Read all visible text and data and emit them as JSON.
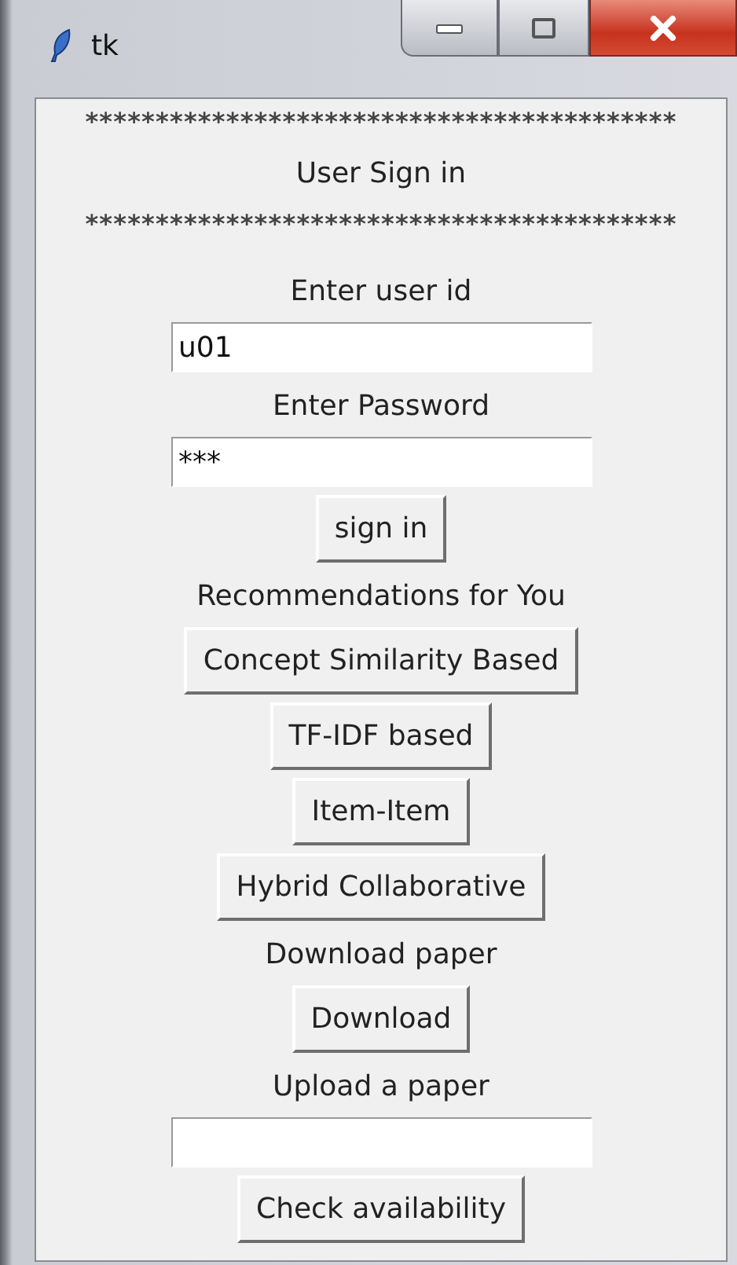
{
  "window": {
    "title": "tk"
  },
  "items": [
    {
      "kind": "separator",
      "text": "******************************************"
    },
    {
      "kind": "heading",
      "text": "User Sign in"
    },
    {
      "kind": "separator",
      "text": "******************************************"
    },
    {
      "kind": "label",
      "text": "Enter user id"
    },
    {
      "kind": "entry",
      "value": "u01"
    },
    {
      "kind": "label",
      "text": "Enter Password"
    },
    {
      "kind": "entry",
      "value": "***"
    },
    {
      "kind": "button",
      "text": "sign in"
    },
    {
      "kind": "label",
      "text": "Recommendations for You"
    },
    {
      "kind": "button",
      "text": "Concept Similarity Based"
    },
    {
      "kind": "button",
      "text": "TF-IDF based"
    },
    {
      "kind": "button",
      "text": "Item-Item"
    },
    {
      "kind": "button",
      "text": "Hybrid Collaborative"
    },
    {
      "kind": "label",
      "text": "Download paper"
    },
    {
      "kind": "button",
      "text": "Download"
    },
    {
      "kind": "label",
      "text": "Upload a paper"
    },
    {
      "kind": "entry"
    },
    {
      "kind": "button",
      "text": "Check availability"
    }
  ]
}
